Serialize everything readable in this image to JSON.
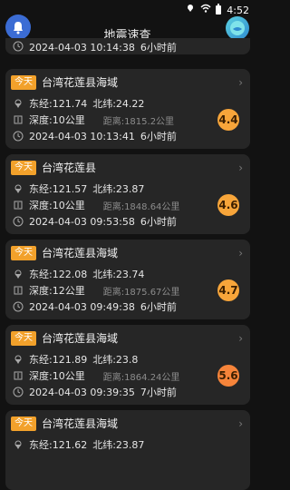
{
  "status": {
    "time": "4:52"
  },
  "app": {
    "title": "地震速查"
  },
  "top_partial": {
    "time": "2024-04-03 10:14:38",
    "ago": "6小时前"
  },
  "cards": [
    {
      "badge": "今天",
      "location": "台湾花莲县海域",
      "lon": "东经:121.74",
      "lat": "北纬:24.22",
      "depth": "深度:10公里",
      "distance": "距离:1815.2公里",
      "datetime": "2024-04-03 10:13:41",
      "ago": "6小时前",
      "mag": "4.4"
    },
    {
      "badge": "今天",
      "location": "台湾花莲县",
      "lon": "东经:121.57",
      "lat": "北纬:23.87",
      "depth": "深度:10公里",
      "distance": "距离:1848.64公里",
      "datetime": "2024-04-03 09:53:58",
      "ago": "6小时前",
      "mag": "4.6"
    },
    {
      "badge": "今天",
      "location": "台湾花莲县海域",
      "lon": "东经:122.08",
      "lat": "北纬:23.74",
      "depth": "深度:12公里",
      "distance": "距离:1875.67公里",
      "datetime": "2024-04-03 09:49:38",
      "ago": "6小时前",
      "mag": "4.7"
    },
    {
      "badge": "今天",
      "location": "台湾花莲县海域",
      "lon": "东经:121.89",
      "lat": "北纬:23.8",
      "depth": "深度:10公里",
      "distance": "距离:1864.24公里",
      "datetime": "2024-04-03 09:39:35",
      "ago": "7小时前",
      "mag": "5.6"
    },
    {
      "badge": "今天",
      "location": "台湾花莲县海域",
      "lon": "东经:121.62",
      "lat": "北纬:23.87"
    }
  ]
}
